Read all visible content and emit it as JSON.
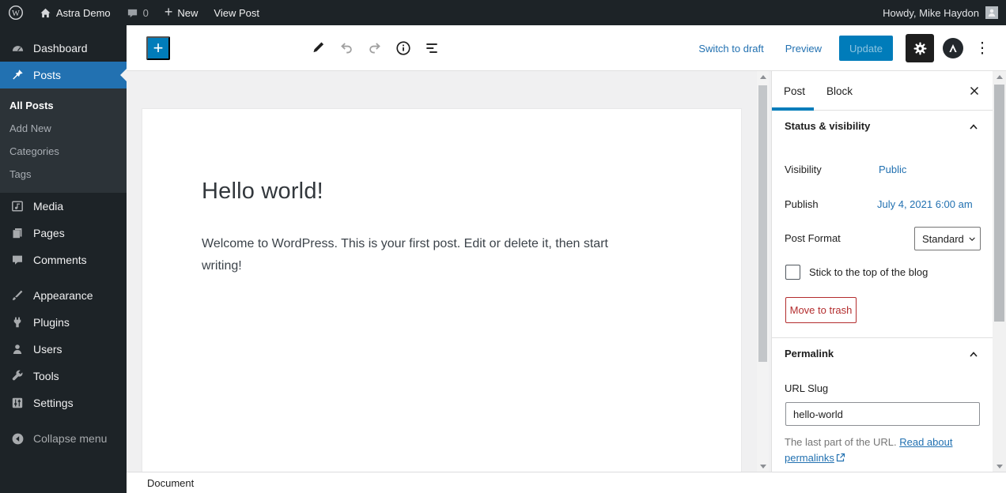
{
  "admin_bar": {
    "site_name": "Astra Demo",
    "comments_count": "0",
    "new_label": "New",
    "view_post_label": "View Post",
    "howdy": "Howdy, Mike Haydon"
  },
  "sidebar": {
    "items": [
      {
        "label": "Dashboard",
        "icon": "dashboard-icon"
      },
      {
        "label": "Posts",
        "icon": "pushpin-icon",
        "active": true
      },
      {
        "label": "Media",
        "icon": "media-icon"
      },
      {
        "label": "Pages",
        "icon": "pages-icon"
      },
      {
        "label": "Comments",
        "icon": "comment-icon"
      },
      {
        "label": "Appearance",
        "icon": "brush-icon"
      },
      {
        "label": "Plugins",
        "icon": "plug-icon"
      },
      {
        "label": "Users",
        "icon": "user-icon"
      },
      {
        "label": "Tools",
        "icon": "wrench-icon"
      },
      {
        "label": "Settings",
        "icon": "sliders-icon"
      }
    ],
    "posts_submenu": [
      {
        "label": "All Posts",
        "current": true
      },
      {
        "label": "Add New"
      },
      {
        "label": "Categories"
      },
      {
        "label": "Tags"
      }
    ],
    "collapse_label": "Collapse menu"
  },
  "editor_toolbar": {
    "inserter_glyph": "+",
    "switch_to_draft": "Switch to draft",
    "preview": "Preview",
    "update": "Update",
    "kebab_glyph": "⋮"
  },
  "content": {
    "title": "Hello world!",
    "paragraph": "Welcome to WordPress. This is your first post. Edit or delete it, then start writing!",
    "breadcrumb": "Document"
  },
  "panel": {
    "tab_post": "Post",
    "tab_block": "Block",
    "status": {
      "title": "Status & visibility",
      "visibility_label": "Visibility",
      "visibility_value": "Public",
      "publish_label": "Publish",
      "publish_value": "July 4, 2021 6:00 am",
      "post_format_label": "Post Format",
      "post_format_value": "Standard",
      "sticky_label": "Stick to the top of the blog",
      "trash_label": "Move to trash"
    },
    "permalink": {
      "title": "Permalink",
      "slug_label": "URL Slug",
      "slug_value": "hello-world",
      "help_prefix": "The last part of the URL. ",
      "help_link": "Read about permalinks"
    }
  },
  "colors": {
    "admin_dark": "#1d2327",
    "submenu_dark": "#2c3338",
    "menu_active_blue": "#2271b1",
    "editor_accent_blue": "#007cba",
    "link_blue": "#2271b1",
    "danger_red": "#b32d2e",
    "canvas_gray": "#f0f0f1"
  }
}
